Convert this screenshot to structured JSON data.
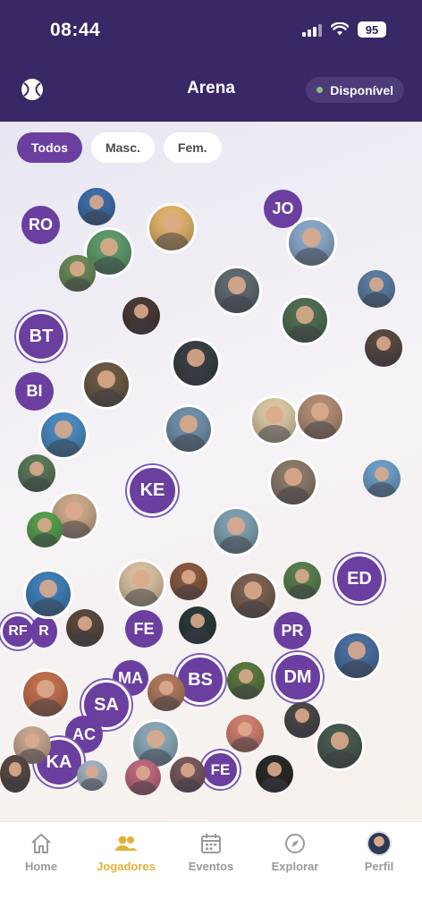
{
  "status_bar": {
    "time": "08:44",
    "battery": "95"
  },
  "header": {
    "title": "Arena",
    "status": "Disponível"
  },
  "filters": [
    "Todos",
    "Masc.",
    "Fem."
  ],
  "bubbles": {
    "ro": "RO",
    "jo": "JO",
    "bt": "BT",
    "bi": "BI",
    "ke": "KE",
    "ed": "ED",
    "rf": "RF",
    "r": "R",
    "fe1": "FE",
    "pr": "PR",
    "ma": "MA",
    "bs": "BS",
    "dm": "DM",
    "sa": "SA",
    "ac": "AC",
    "ka": "KA",
    "fe2": "FE"
  },
  "tabs": [
    "Home",
    "Jogadores",
    "Eventos",
    "Explorar",
    "Perfil"
  ],
  "colors": {
    "header": "#3a2766",
    "accent": "#6a3fa0",
    "tab_active": "#e0b33a",
    "status_dot": "#86c17c"
  }
}
